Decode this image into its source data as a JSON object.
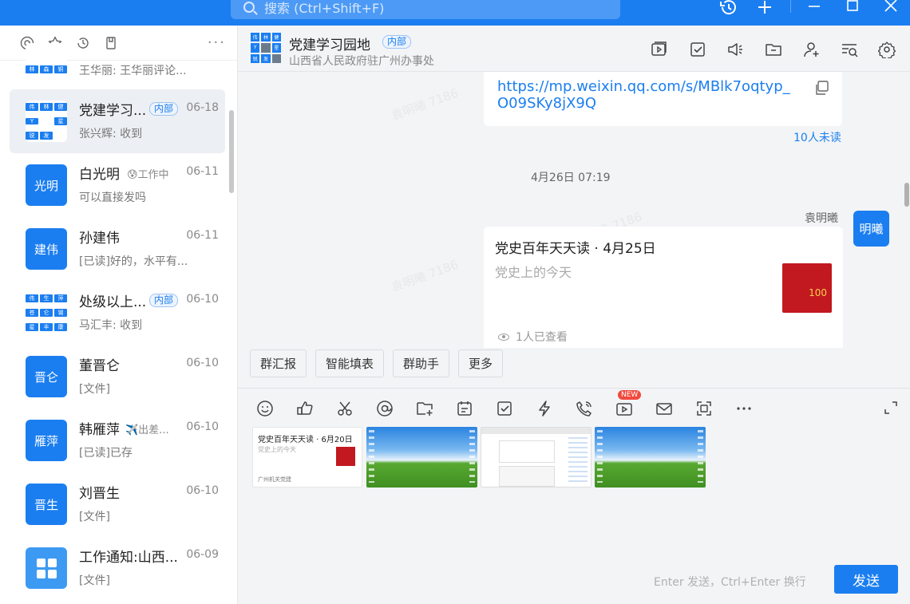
{
  "search": {
    "placeholder": "搜索 (Ctrl+Shift+F)"
  },
  "sidebar": {
    "conversations": [
      {
        "name": "",
        "preview": "王华丽: 王华丽评论...",
        "date": "",
        "avatar_cells": [
          "林",
          "森",
          "铜"
        ]
      },
      {
        "name": "党建学习...",
        "tag": "内部",
        "preview": "张兴辉: 收到",
        "date": "06-18",
        "avatar_cells": [
          "伟",
          "林",
          "健",
          "Y",
          "",
          "星",
          "锐",
          "发",
          ""
        ]
      },
      {
        "name": "白光明",
        "status": "😰工作中",
        "preview": "可以直接发吗",
        "date": "06-11",
        "avatar": "光明"
      },
      {
        "name": "孙建伟",
        "preview": "[已读]好的，水平有...",
        "date": "06-11",
        "avatar": "建伟"
      },
      {
        "name": "处级以上...",
        "tag": "内部",
        "preview": "马汇丰: 收到",
        "date": "06-10",
        "avatar_cells": [
          "伟",
          "生",
          "萍",
          "苍",
          "仑",
          "锡",
          "星",
          "丰",
          "康"
        ]
      },
      {
        "name": "董晋仑",
        "preview": "[文件]",
        "date": "06-10",
        "avatar": "晋仑"
      },
      {
        "name": "韩雁萍",
        "status": "✈️出差...",
        "preview": "[已读]已存",
        "date": "06-10",
        "avatar": "雁萍"
      },
      {
        "name": "刘晋生",
        "preview": "[文件]",
        "date": "06-10",
        "avatar": "晋生"
      },
      {
        "name": "工作通知:山西...",
        "preview": "[文件]",
        "date": "06-09"
      }
    ]
  },
  "chat": {
    "title": "党建学习园地",
    "tag": "内部",
    "subtitle": "山西省人民政府驻广州办事处",
    "avatar_cells": [
      "伟",
      "林",
      "健",
      "Y",
      "",
      "星",
      "锐",
      "发",
      ""
    ],
    "link_url": "https://mp.weixin.qq.com/s/MBlk7oqtyp_O09SKy8jX9Q",
    "unread": "10人未读",
    "timestamp": "4月26日 07:19",
    "sender": "袁明曦",
    "me_avatar": "明曦",
    "card": {
      "title": "党史百年天天读 · 4月25日",
      "subtitle": "党史上的今天",
      "thumb_text": "100",
      "views": "1人已查看"
    },
    "watermark": "袁明曦 7186"
  },
  "quick_actions": [
    "群汇报",
    "智能填表",
    "群助手",
    "更多"
  ],
  "composer": {
    "new_badge": "NEW",
    "thumb_doc": {
      "title": "党史百年天天读 · 6月20日",
      "subtitle": "党史上的今天",
      "footer": "广州机关党建"
    },
    "hint": "Enter 发送，Ctrl+Enter 换行",
    "send_label": "发送"
  },
  "colors": {
    "accent": "#1b7ef0",
    "background": "#f3f4f6",
    "badge": "#f04a3e"
  },
  "icons": {
    "topbar": [
      "history-icon",
      "add-icon",
      "minimize-icon",
      "maximize-icon",
      "close-icon"
    ],
    "sidebar_tools": [
      "at-mention-icon",
      "star-icon",
      "recent-icon",
      "bookmark-icon",
      "more-icon"
    ],
    "header": [
      "video-meeting-icon",
      "task-icon",
      "announcement-icon",
      "folder-icon",
      "add-member-icon",
      "search-history-icon",
      "settings-icon"
    ],
    "composer": [
      "emoji-icon",
      "like-icon",
      "screenshot-icon",
      "at-icon",
      "add-folder-icon",
      "schedule-icon",
      "todo-icon",
      "flash-icon",
      "phone-icon",
      "live-icon",
      "mail-icon",
      "scan-icon",
      "more-icon",
      "expand-icon"
    ]
  }
}
